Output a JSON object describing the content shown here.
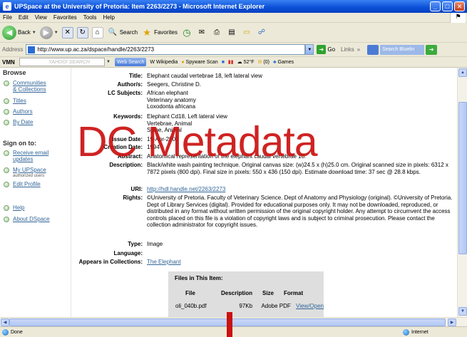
{
  "window": {
    "title": "UPSpace at the University of Pretoria: Item 2263/2273 - Microsoft Internet Explorer",
    "minimize": "_",
    "maximize": "□",
    "close": "✕"
  },
  "menu": [
    "File",
    "Edit",
    "View",
    "Favorites",
    "Tools",
    "Help"
  ],
  "toolbar": {
    "back_label": "Back",
    "search_label": "Search",
    "favorites_label": "Favorites"
  },
  "address": {
    "label": "Address",
    "url": "http://www.up.ac.za/dspace/handle/2263/2273",
    "go_label": "Go",
    "links_label": "Links",
    "search_box": "Search Bluelin"
  },
  "yahoo_toolbar": {
    "vmn": "VMN",
    "search_placeholder": "YAHOO! SEARCH",
    "web_search": "Web Search",
    "wikipedia": "Wikipedia",
    "spyware": "Spyware Scan",
    "weather": "52°F",
    "mail": "(0)",
    "games": "Games"
  },
  "sidebar": {
    "browse_heading": "Browse",
    "browse_items": [
      {
        "label_line1": "Communities",
        "label_line2": "& Collections"
      },
      {
        "label_line1": "Titles",
        "label_line2": ""
      },
      {
        "label_line1": "Authors",
        "label_line2": ""
      },
      {
        "label_line1": "By Date",
        "label_line2": ""
      }
    ],
    "signon_heading": "Sign on to:",
    "signon_items": [
      {
        "label_line1": "Receive email",
        "label_line2": "updates"
      },
      {
        "label_line1": "My UPSpace",
        "label_line2": "",
        "sub": "authorized users"
      },
      {
        "label_line1": "Edit Profile",
        "label_line2": ""
      }
    ],
    "help": "Help",
    "about": "About DSpace"
  },
  "metadata": {
    "title_label": "Title:",
    "title_value": "Elephant caudal vertebrae 18, left lateral view",
    "author_label": "Author/s:",
    "author_value": "Seegers, Christine D.",
    "lc_label": "LC Subjects:",
    "lc_values": [
      "African elephant",
      "Veterinary anatomy",
      "Loxodonta africana"
    ],
    "keywords_label": "Keywords:",
    "keywords_values": [
      "Elephant Cd18, Left lateral view",
      "Vertebrae, Animal",
      "Spine, Animal"
    ],
    "issue_label": "Issue Date:",
    "issue_value": "19-Apr-2007",
    "creation_label": "Creation Date:",
    "creation_value": "1994",
    "abstract_label": "Abstract:",
    "abstract_value": "Anatomical representation of the elephant caudal vertebrae 18.",
    "description_label": "Description:",
    "description_value": "Black/white wash painting technique. Original canvas size: (w)24.5 x (h)25.0 cm. Original scanned size in pixels: 6312 x 7872 pixels (800 dpi). Final size in pixels: 550 x 436 (150 dpi). Estimate download time: 37 sec @ 28.8 kbps.",
    "uri_label": "URI:",
    "uri_value": "http://hdl.handle.net/2263/2273",
    "rights_label": "Rights:",
    "rights_value": "©University of Pretoria. Faculty of Veterinary Science. Dept of Anatomy and Physiology (original). ©University of Pretoria. Dept of Library Services (digital). Provided for educational purposes only. It may not be downloaded, reproduced, or distributed in any format without written permission of the original copyright holder. Any attempt to circumvent the access controls placed on this file is a violation of copyright laws and is subject to criminal prosecution. Please contact the collection administrator for copyright issues.",
    "type_label": "Type:",
    "type_value": "Image",
    "language_label": "Language:",
    "language_value": "",
    "collections_label": "Appears in Collections:",
    "collections_value": "The Elephant"
  },
  "files": {
    "heading": "Files in This Item:",
    "columns": [
      "File",
      "Description",
      "Size",
      "Format"
    ],
    "rows": [
      {
        "file": "oli_040b.pdf",
        "description": "",
        "size": "97Kb",
        "format": "Adobe PDF",
        "action": "View/Open"
      }
    ]
  },
  "overlay_text": "DC Metadata",
  "status": {
    "left": "Done",
    "zone": "Internet"
  },
  "colors": {
    "titlebar": "#0a4fd6",
    "link": "#336699",
    "overlay": "#cc1111",
    "files_bg": "#dedede"
  }
}
